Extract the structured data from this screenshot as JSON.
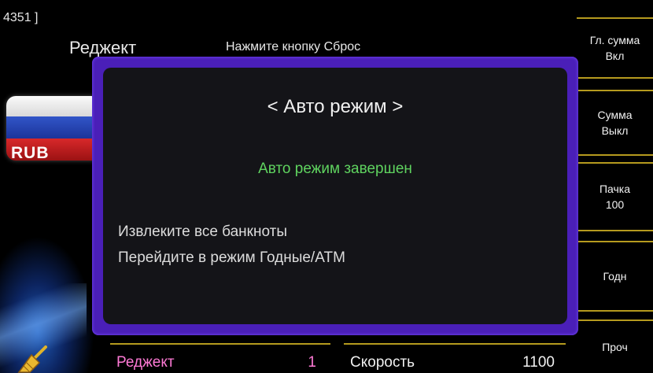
{
  "header": {
    "counter": "4351 ]",
    "mode": "Реджект",
    "hint": "Нажмите кнопку Сброс"
  },
  "currency": {
    "code": "RUB",
    "flag_colors": [
      "#fafafa",
      "#2a46b8",
      "#c81f20"
    ]
  },
  "softkeys": [
    {
      "line1": "Гл. сумма",
      "line2": "Вкл"
    },
    {
      "line1": "Сумма",
      "line2": "Выкл"
    },
    {
      "line1": "Пачка",
      "line2": "100"
    },
    {
      "line1": "Годн",
      "line2": ""
    },
    {
      "line1": "Проч",
      "line2": ""
    }
  ],
  "dialog": {
    "title": "< Авто режим >",
    "status": "Авто режим завершен",
    "line1": "Извлеките все банкноты",
    "line2": "Перейдите в режим Годные/ATM"
  },
  "bottom": {
    "reject_label": "Реджект",
    "reject_value": "1",
    "speed_label": "Скорость",
    "speed_value": "1100"
  },
  "colors": {
    "accent_gold": "#b59a1e",
    "dialog_border": "#4a1fb8",
    "status_green": "#5fd35f",
    "reject_pink": "#ff7ad6"
  },
  "icons": {
    "broom": "broom-icon"
  }
}
